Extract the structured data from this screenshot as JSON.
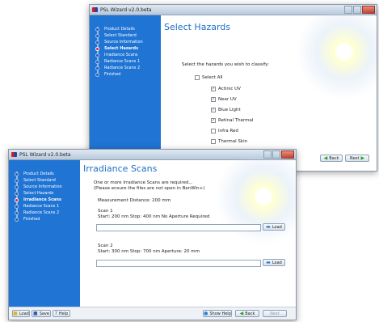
{
  "back_window": {
    "title": "PSL Wizard v2.0.beta",
    "heading": "Select Hazards",
    "steps": [
      "Product Details",
      "Select Standard",
      "Source Information",
      "Select Hazards",
      "Irradiance Scans",
      "Radiance Scans 1",
      "Radiance Scans 2",
      "Finished"
    ],
    "active_step": 3,
    "instruction": "Select the hazards you wish to classify:",
    "select_all": {
      "label": "Select All",
      "checked": false
    },
    "hazards": [
      {
        "label": "Actinic UV",
        "checked": true
      },
      {
        "label": "Near UV",
        "checked": true
      },
      {
        "label": "Blue Light",
        "checked": true
      },
      {
        "label": "Retinal Thermal",
        "checked": true
      },
      {
        "label": "Infra Red",
        "checked": false
      },
      {
        "label": "Thermal Skin",
        "checked": false
      }
    ],
    "buttons": {
      "back": "Back",
      "next": "Next"
    }
  },
  "front_window": {
    "title": "PSL Wizard v2.0.beta",
    "heading": "Irradiance Scans",
    "steps": [
      "Product Details",
      "Select Standard",
      "Source Information",
      "Select Hazards",
      "Irradiance Scans",
      "Radiance Scans 1",
      "Radiance Scans 2",
      "Finished"
    ],
    "active_step": 4,
    "intro_line1": "One or more Irradiance Scans are required...",
    "intro_line2": "(Please ensure the files are not open in BenWin+)",
    "measurement": "Measurement Distance: 200 mm",
    "scan1": {
      "title": "Scan 1",
      "details": "Start: 200 nm    Stop: 400 nm    No Aperture Required",
      "value": "",
      "load": "Load"
    },
    "scan2": {
      "title": "Scan 2",
      "details": "Start: 300 nm    Stop: 700 nm    Aperture: 20 mm",
      "value": "",
      "load": "Load"
    },
    "footer": {
      "load": "Load",
      "save": "Save",
      "help": "Help",
      "show_help": "Show Help",
      "back": "Back",
      "next": "Next"
    }
  }
}
